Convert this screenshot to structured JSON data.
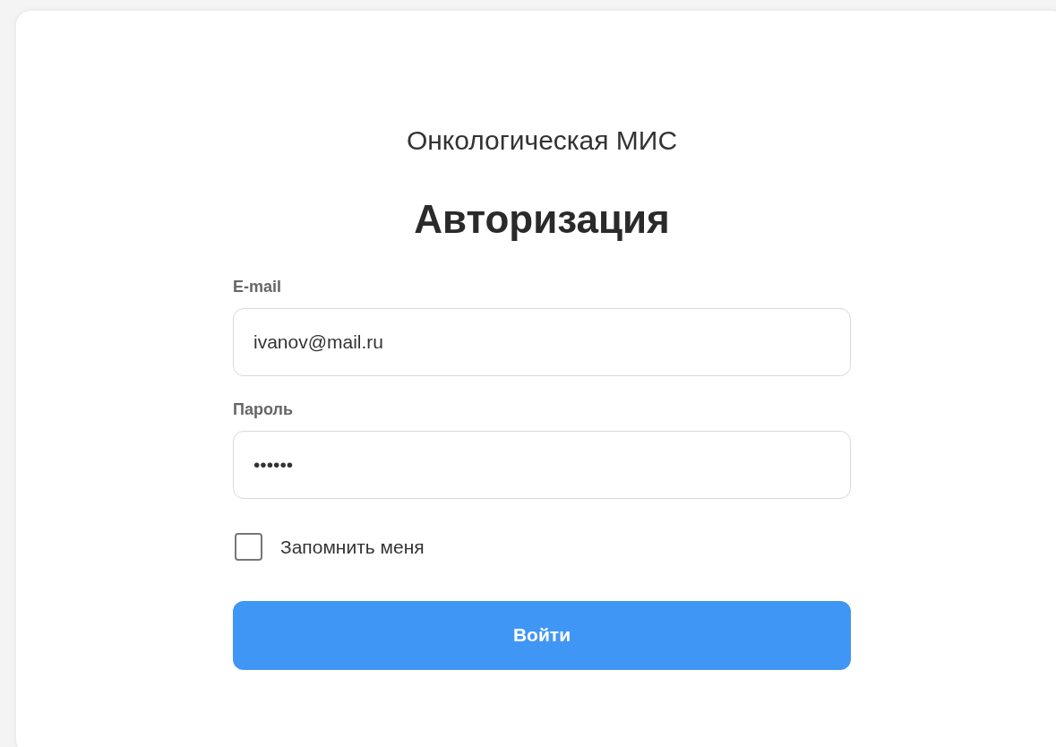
{
  "app_title": "Онкологическая МИС",
  "heading": "Авторизация",
  "fields": [
    {
      "label": "E-mail",
      "value": "ivanov@mail.ru"
    },
    {
      "label": "Пароль",
      "value": "••••••"
    }
  ],
  "remember": {
    "label": "Запомнить меня",
    "checked": false
  },
  "submit_button": "Войти"
}
